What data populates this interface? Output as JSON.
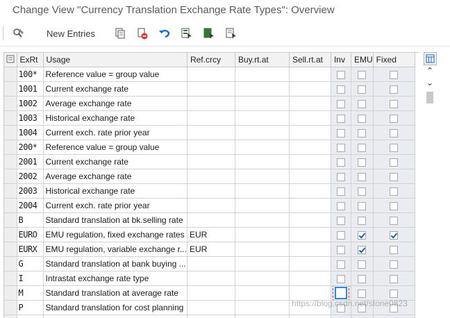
{
  "window": {
    "title": "Change View \"Currency Translation Exchange Rate Types\": Overview"
  },
  "toolbar": {
    "new_entries_label": "New Entries",
    "icons": [
      "display-change-icon",
      "copy-icon",
      "delete-icon",
      "undo-icon",
      "select-all-icon",
      "select-block-icon",
      "deselect-all-icon"
    ]
  },
  "table": {
    "columns": [
      "ExRt",
      "Usage",
      "Ref.crcy",
      "Buy.rt.at",
      "Sell.rt.at",
      "Inv",
      "EMU",
      "Fixed"
    ],
    "rows": [
      {
        "exrt": "100*",
        "usage": "Reference value = group value",
        "ref": "",
        "buy": "",
        "sell": "",
        "inv": false,
        "emu": false,
        "fixed": false
      },
      {
        "exrt": "1001",
        "usage": "Current exchange rate",
        "ref": "",
        "buy": "",
        "sell": "",
        "inv": false,
        "emu": false,
        "fixed": false
      },
      {
        "exrt": "1002",
        "usage": "Average exchange rate",
        "ref": "",
        "buy": "",
        "sell": "",
        "inv": false,
        "emu": false,
        "fixed": false
      },
      {
        "exrt": "1003",
        "usage": "Historical exchange rate",
        "ref": "",
        "buy": "",
        "sell": "",
        "inv": false,
        "emu": false,
        "fixed": false
      },
      {
        "exrt": "1004",
        "usage": "Current exch. rate prior year",
        "ref": "",
        "buy": "",
        "sell": "",
        "inv": false,
        "emu": false,
        "fixed": false
      },
      {
        "exrt": "200*",
        "usage": "Reference value = group value",
        "ref": "",
        "buy": "",
        "sell": "",
        "inv": false,
        "emu": false,
        "fixed": false
      },
      {
        "exrt": "2001",
        "usage": "Current exchange rate",
        "ref": "",
        "buy": "",
        "sell": "",
        "inv": false,
        "emu": false,
        "fixed": false
      },
      {
        "exrt": "2002",
        "usage": "Average exchange rate",
        "ref": "",
        "buy": "",
        "sell": "",
        "inv": false,
        "emu": false,
        "fixed": false
      },
      {
        "exrt": "2003",
        "usage": "Historical exchange rate",
        "ref": "",
        "buy": "",
        "sell": "",
        "inv": false,
        "emu": false,
        "fixed": false
      },
      {
        "exrt": "2004",
        "usage": "Current exch. rate prior year",
        "ref": "",
        "buy": "",
        "sell": "",
        "inv": false,
        "emu": false,
        "fixed": false
      },
      {
        "exrt": "B",
        "usage": "Standard translation at bk.selling rate",
        "ref": "",
        "buy": "",
        "sell": "",
        "inv": false,
        "emu": false,
        "fixed": false
      },
      {
        "exrt": "EURO",
        "usage": "EMU regulation, fixed exchange rates",
        "ref": "EUR",
        "buy": "",
        "sell": "",
        "inv": false,
        "emu": true,
        "fixed": true
      },
      {
        "exrt": "EURX",
        "usage": "EMU regulation, variable exchange r...",
        "ref": "EUR",
        "buy": "",
        "sell": "",
        "inv": false,
        "emu": true,
        "fixed": false
      },
      {
        "exrt": "G",
        "usage": "Standard translation at bank buying ...",
        "ref": "",
        "buy": "",
        "sell": "",
        "inv": false,
        "emu": false,
        "fixed": false
      },
      {
        "exrt": "I",
        "usage": "Intrastat exchange rate type",
        "ref": "",
        "buy": "",
        "sell": "",
        "inv": false,
        "emu": false,
        "fixed": false
      },
      {
        "exrt": "M",
        "usage": "Standard translation at average rate",
        "ref": "",
        "buy": "",
        "sell": "",
        "inv": false,
        "emu": false,
        "fixed": false,
        "focus": true
      },
      {
        "exrt": "P",
        "usage": "Standard translation for cost planning",
        "ref": "",
        "buy": "",
        "sell": "",
        "inv": false,
        "emu": false,
        "fixed": false
      },
      {
        "exrt": "",
        "usage": "",
        "ref": "",
        "buy": "",
        "sell": "",
        "inv": false,
        "emu": false,
        "fixed": false
      }
    ]
  },
  "watermark": "https://blog.csdn.net/stone0823"
}
